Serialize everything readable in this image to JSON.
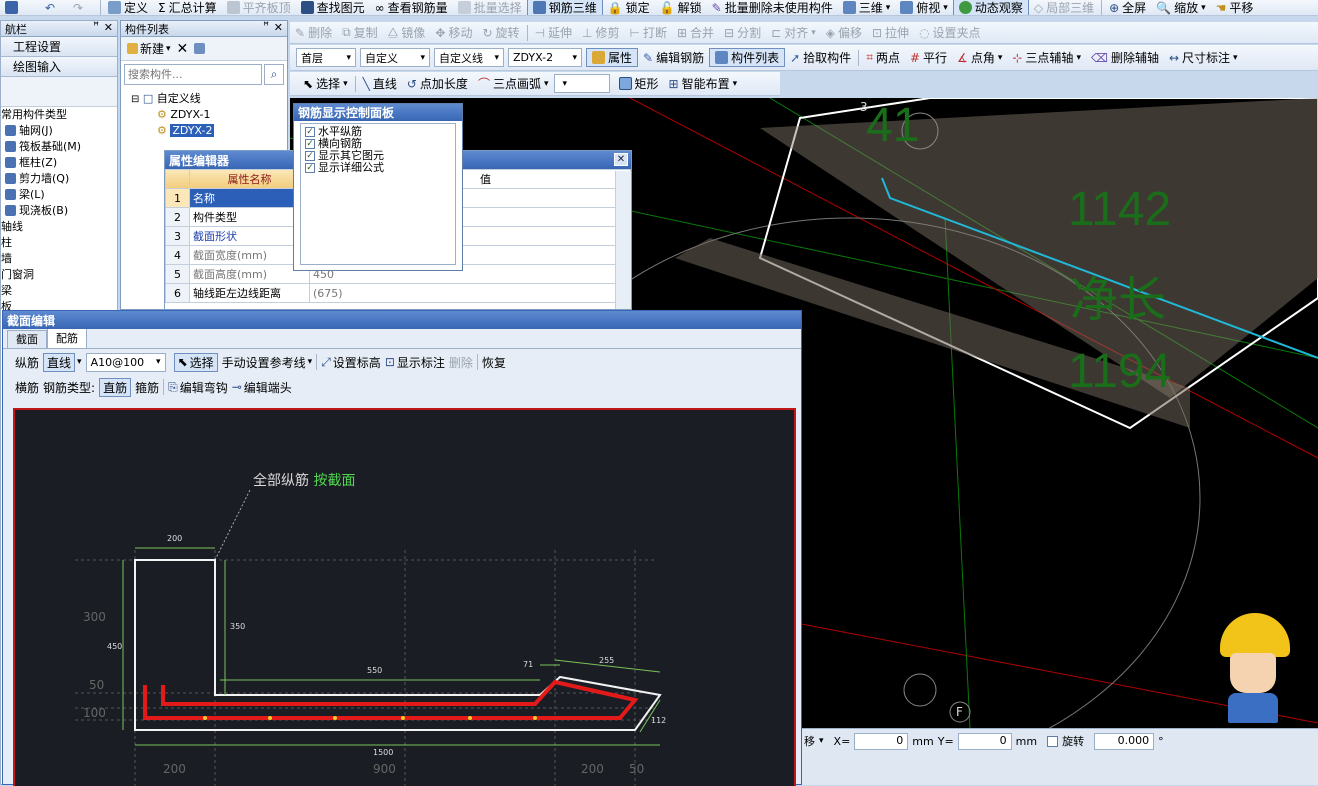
{
  "toolbar1": {
    "items": [
      "定义",
      "汇总计算",
      "平齐板顶",
      "查找图元",
      "查看钢筋量",
      "批量选择",
      "钢筋三维",
      "锁定",
      "解锁",
      "批量删除未使用构件",
      "三维",
      "俯视",
      "动态观察",
      "局部三维",
      "全屏",
      "缩放",
      "平移"
    ]
  },
  "toolbar2": {
    "items": [
      "删除",
      "复制",
      "镜像",
      "移动",
      "旋转",
      "延伸",
      "修剪",
      "打断",
      "合并",
      "分割",
      "对齐",
      "偏移",
      "拉伸",
      "设置夹点"
    ]
  },
  "toolbar3": {
    "floor": "首层",
    "category": "自定义",
    "type": "自定义线",
    "component": "ZDYX-2",
    "items": [
      "属性",
      "编辑钢筋",
      "构件列表",
      "拾取构件",
      "两点",
      "平行",
      "点角",
      "三点辅轴",
      "删除辅轴",
      "尺寸标注"
    ]
  },
  "toolbar4": {
    "items": [
      "选择",
      "直线",
      "点加长度",
      "三点画弧",
      "矩形",
      "智能布置"
    ]
  },
  "left_nav": {
    "title": "航栏",
    "sections": [
      "工程设置",
      "绘图输入"
    ],
    "group": "常用构件类型",
    "items": [
      "轴网(J)",
      "筏板基础(M)",
      "框柱(Z)",
      "剪力墙(Q)",
      "梁(L)",
      "现浇板(B)"
    ],
    "categories": [
      "轴线",
      "柱",
      "墙",
      "门窗洞",
      "梁",
      "板"
    ]
  },
  "comp_list": {
    "title": "构件列表",
    "new_label": "新建",
    "search_placeholder": "搜索构件...",
    "root": "自定义线",
    "items": [
      "ZDYX-1",
      "ZDYX-2"
    ]
  },
  "prop_editor": {
    "title": "属性编辑器",
    "col_name": "属性名称",
    "col_value": "值",
    "rows": [
      {
        "n": "1",
        "name": "名称",
        "value": ""
      },
      {
        "n": "2",
        "name": "构件类型",
        "value": ""
      },
      {
        "n": "3",
        "name": "截面形状",
        "value": ""
      },
      {
        "n": "4",
        "name": "截面宽度(mm)",
        "value": ""
      },
      {
        "n": "5",
        "name": "截面高度(mm)",
        "value": "450"
      },
      {
        "n": "6",
        "name": "轴线距左边线距离",
        "value": "(675)"
      }
    ]
  },
  "rebar_panel": {
    "title": "钢筋显示控制面板",
    "options": [
      "水平纵筋",
      "横向钢筋",
      "显示其它图元",
      "显示详细公式"
    ]
  },
  "view3d": {
    "labels": [
      "41",
      "1142",
      "净长",
      "1194"
    ],
    "axis_labels": [
      "3",
      "F"
    ]
  },
  "section_editor": {
    "title": "截面编辑",
    "tabs": [
      "截面",
      "配筋"
    ],
    "row1": {
      "label": "纵筋",
      "mode": "直线",
      "spec": "A10@100",
      "select": "选择",
      "ref": "手动设置参考线",
      "set_height": "设置标高",
      "show_dim": "显示标注",
      "delete": "删除",
      "restore": "恢复"
    },
    "row2": {
      "label": "横筋",
      "type_label": "钢筋类型:",
      "type_straight": "直筋",
      "type_stirrup": "箍筋",
      "edit_hook": "编辑弯钩",
      "edit_end": "编辑端头"
    },
    "note_prefix": "全部纵筋",
    "note_action": "按截面",
    "dims": [
      "200",
      "350",
      "550",
      "71",
      "255",
      "450",
      "112",
      "1500"
    ],
    "side_dims": [
      "300",
      "50",
      "100"
    ],
    "bottom_dims": [
      "200",
      "900",
      "200",
      "50"
    ]
  },
  "statusbar": {
    "x_label": "X=",
    "x_value": "0",
    "y_label": "Y=",
    "y_value": "0",
    "unit": "mm",
    "rotate_label": "旋转",
    "rotate_value": "0.000",
    "deg": "°",
    "frag": "移"
  }
}
